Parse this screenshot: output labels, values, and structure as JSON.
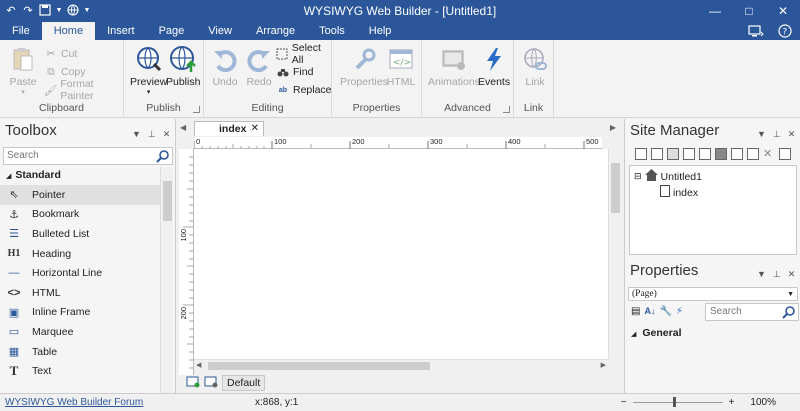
{
  "window": {
    "title": "WYSIWYG Web Builder - [Untitled1]",
    "min": "—",
    "max": "□",
    "close": "✕"
  },
  "quick_access": [
    "undo-icon",
    "redo-icon",
    "save-icon",
    "dropdown-icon",
    "globe-icon",
    "dropdown-icon"
  ],
  "ribbon": {
    "tabs": [
      "File",
      "Home",
      "Insert",
      "Page",
      "View",
      "Arrange",
      "Tools",
      "Help"
    ],
    "active_tab": "Home",
    "groups": {
      "clipboard": {
        "label": "Clipboard",
        "paste": "Paste",
        "cut": "Cut",
        "copy": "Copy",
        "format_painter": "Format Painter"
      },
      "publish": {
        "label": "Publish",
        "preview": "Preview",
        "publish": "Publish"
      },
      "editing": {
        "label": "Editing",
        "undo": "Undo",
        "redo": "Redo",
        "select_all": "Select All",
        "find": "Find",
        "replace": "Replace"
      },
      "properties": {
        "label": "Properties",
        "properties": "Properties",
        "html": "HTML"
      },
      "advanced": {
        "label": "Advanced",
        "animations": "Animations",
        "events": "Events"
      },
      "link": {
        "label": "Link",
        "link": "Link"
      }
    }
  },
  "toolbox": {
    "title": "Toolbox",
    "search_placeholder": "Search",
    "section": "Standard",
    "items": [
      {
        "label": "Pointer",
        "icon": "pointer-icon",
        "glyph": "⇖"
      },
      {
        "label": "Bookmark",
        "icon": "anchor-icon",
        "glyph": "⚓"
      },
      {
        "label": "Bulleted List",
        "icon": "list-icon",
        "glyph": "☰"
      },
      {
        "label": "Heading",
        "icon": "heading-icon",
        "glyph": "H1"
      },
      {
        "label": "Horizontal Line",
        "icon": "line-icon",
        "glyph": "—"
      },
      {
        "label": "HTML",
        "icon": "code-icon",
        "glyph": "<>"
      },
      {
        "label": "Inline Frame",
        "icon": "frame-icon",
        "glyph": "▣"
      },
      {
        "label": "Marquee",
        "icon": "marquee-icon",
        "glyph": "▭"
      },
      {
        "label": "Table",
        "icon": "table-icon",
        "glyph": "▦"
      },
      {
        "label": "Text",
        "icon": "text-icon",
        "glyph": "T"
      }
    ]
  },
  "editor": {
    "tab": "index",
    "ruler_h": [
      "0",
      "100",
      "200",
      "300",
      "400",
      "500"
    ],
    "ruler_v": [
      "100",
      "200"
    ],
    "bottom_label": "Default"
  },
  "site_manager": {
    "title": "Site Manager",
    "root": "Untitled1",
    "child": "index"
  },
  "properties": {
    "title": "Properties",
    "selection": "(Page)",
    "search_placeholder": "Search",
    "section": "General"
  },
  "status": {
    "link": "WYSIWYG Web Builder Forum",
    "coords": "x:868, y:1",
    "zoom": "100%"
  },
  "colors": {
    "accent": "#2b579a"
  }
}
